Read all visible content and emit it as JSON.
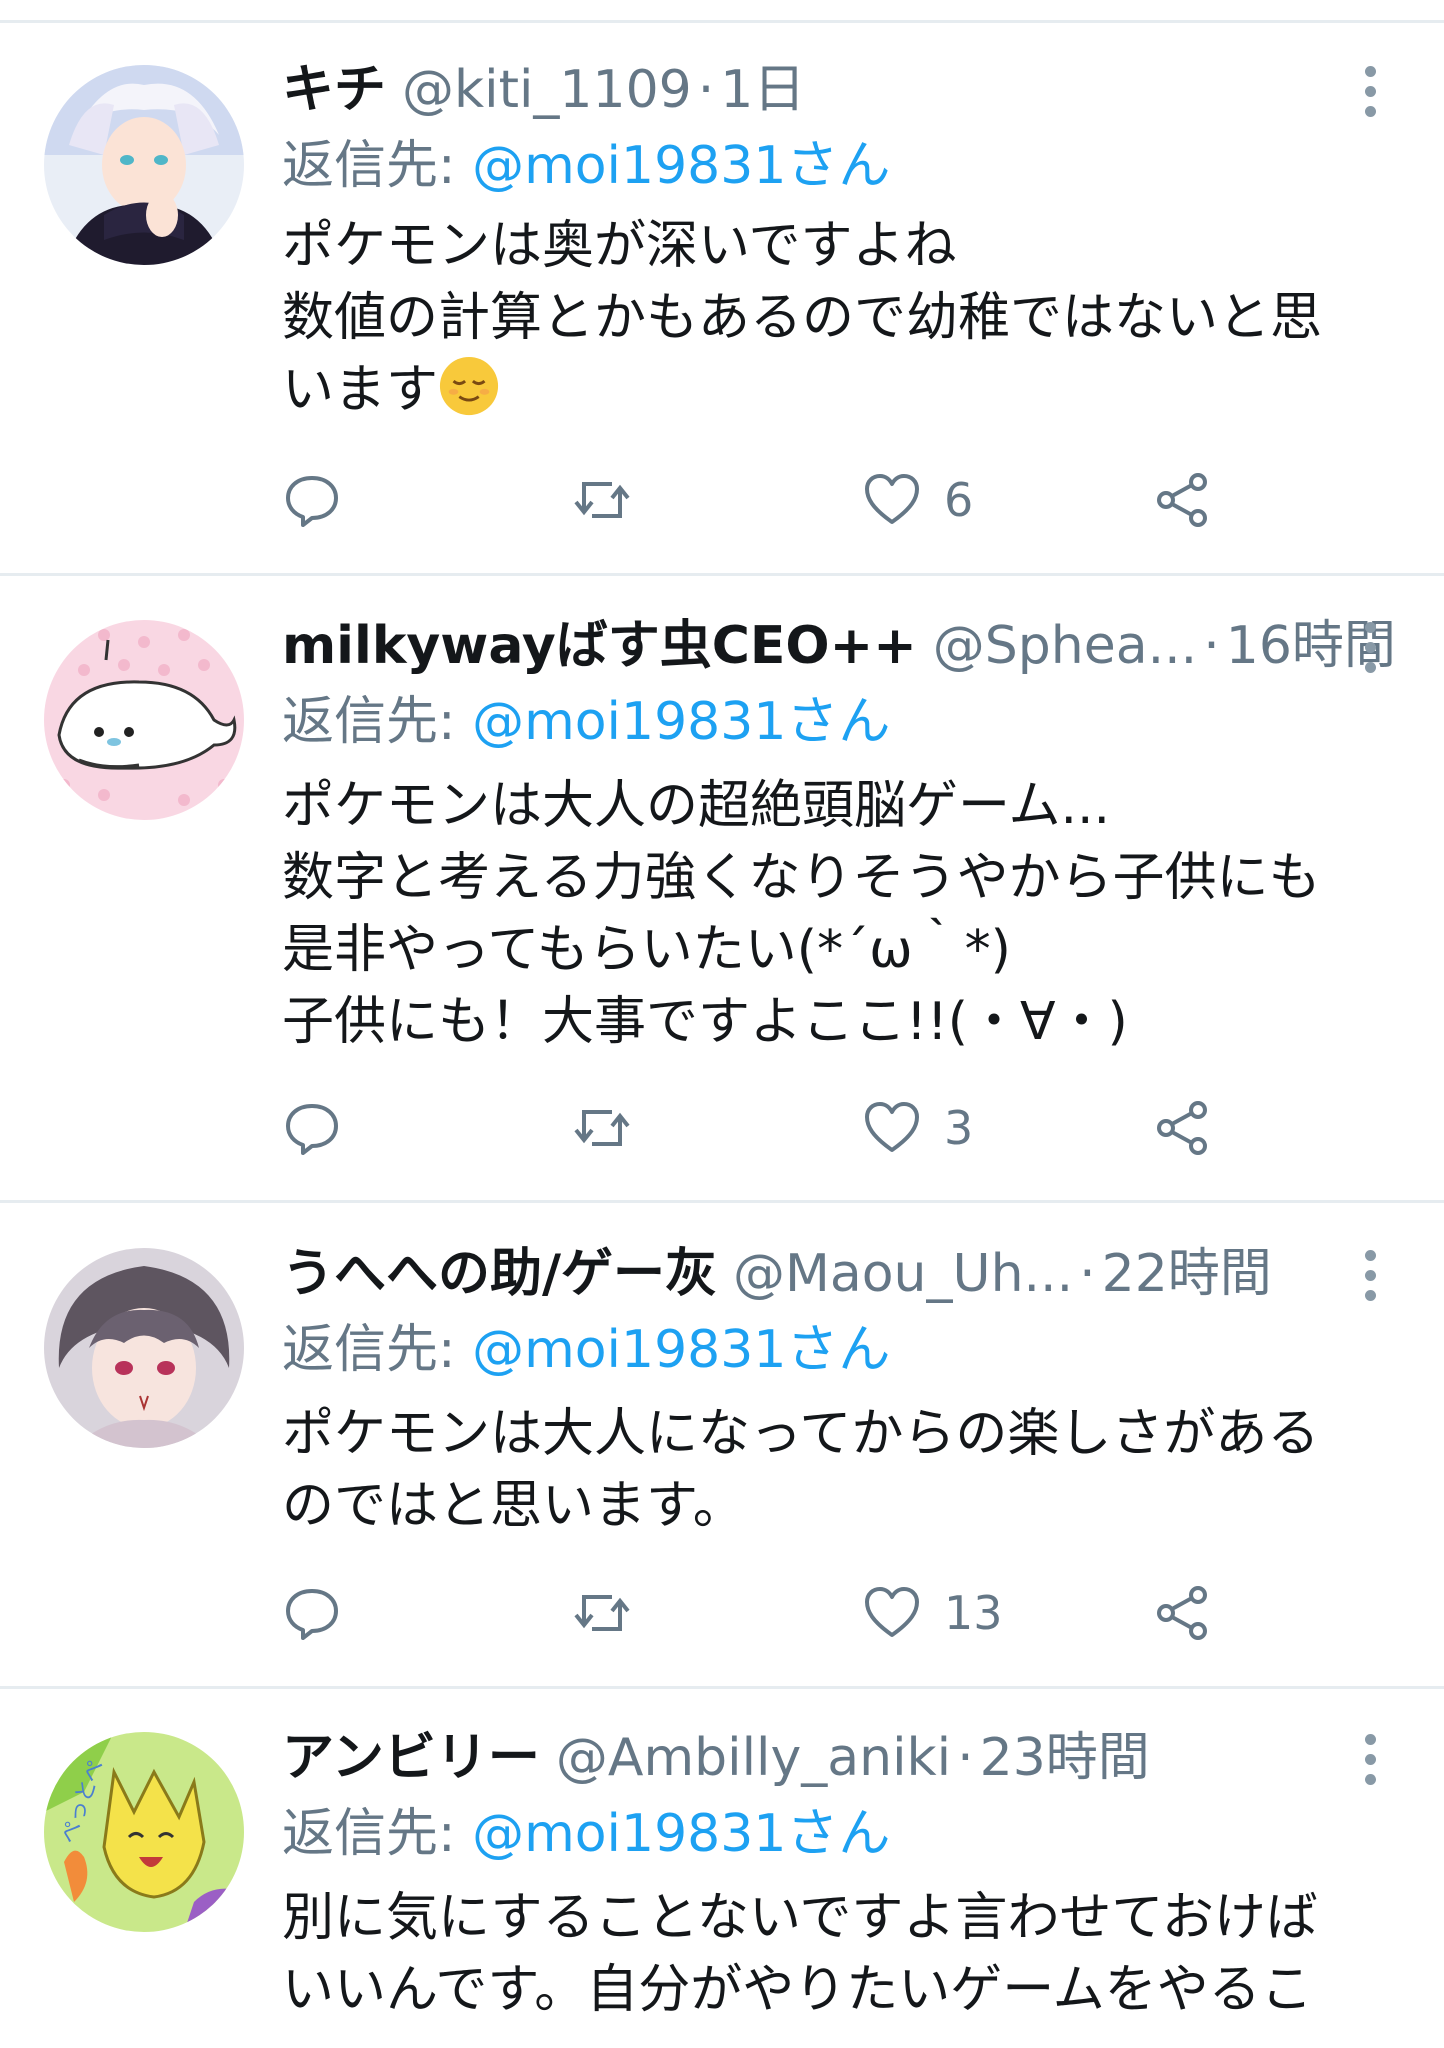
{
  "tweets": [
    {
      "display_name": "キチ",
      "handle": "@kiti_1109",
      "separator": "·",
      "time": "1日",
      "reply_label": "返信先:",
      "reply_mention": "@moi19831さん",
      "body_lines": [
        "ポケモンは奥が深いですよね",
        "数値の計算とかもあるので幼稚ではないと思",
        "います"
      ],
      "emoji": "relieved-face-emoji",
      "like_count": "6",
      "avatar": "white-haired-anime-character-avatar"
    },
    {
      "display_name": "milkywayばす虫CEO++",
      "handle": "@Sphea...",
      "separator": "·",
      "time": "16時間",
      "reply_label": "返信先:",
      "reply_mention": "@moi19831さん",
      "body_lines": [
        "ポケモンは大人の超絶頭脳ゲーム...",
        "数字と考える力強くなりそうやから子供にも",
        "是非やってもらいたい(*´ω｀*)",
        "子供にも！大事ですよここ!!(・∀・)"
      ],
      "like_count": "3",
      "avatar": "white-seal-on-pink-dots-avatar"
    },
    {
      "display_name": "うへへの助/ゲー灰",
      "handle": "@Maou_Uh...",
      "separator": "·",
      "time": "22時間",
      "reply_label": "返信先:",
      "reply_mention": "@moi19831さん",
      "body_lines": [
        "ポケモンは大人になってからの楽しさがある",
        "のではと思います。"
      ],
      "like_count": "13",
      "avatar": "gray-haired-anime-character-avatar"
    },
    {
      "display_name": "アンビリー",
      "handle": "@Ambilly_aniki",
      "separator": "·",
      "time": "23時間",
      "reply_label": "返信先:",
      "reply_mention": "@moi19831さん",
      "body_lines": [
        "別に気にすることないですよ言わせておけば",
        "いいんです。自分がやりたいゲームをやるこ"
      ],
      "avatar": "yellow-cartoon-cat-avatar"
    }
  ],
  "colors": {
    "text": "#14171a",
    "secondary": "#657786",
    "accent": "#1da1f2",
    "divider": "#e6ecf0"
  }
}
